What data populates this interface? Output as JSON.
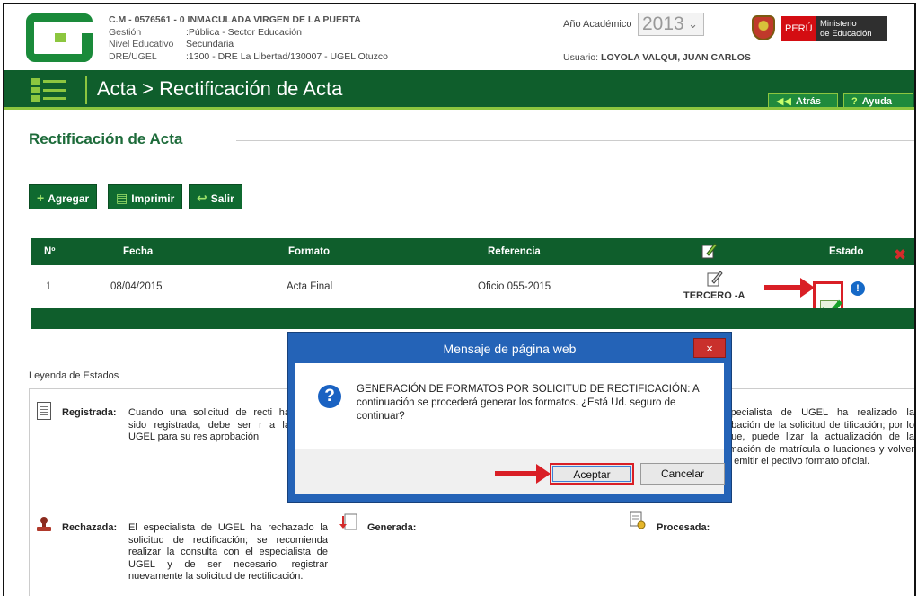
{
  "header": {
    "cm_line": "C.M - 0576561 - 0  INMACULADA VIRGEN DE LA PUERTA",
    "rows": [
      {
        "label": "Gestión",
        "value": ":Pública - Sector Educación"
      },
      {
        "label": "Nivel Educativo",
        "value": "Secundaria"
      },
      {
        "label": "DRE/UGEL",
        "value": ":1300 - DRE La Libertad/130007 - UGEL Otuzco"
      }
    ],
    "anio_label": "Año Académico",
    "anio_value": "2013",
    "usuario_label": "Usuario:",
    "usuario_value": "LOYOLA VALQUI, JUAN CARLOS",
    "peru_label": "PERÚ",
    "ministerio_line1": "Ministerio",
    "ministerio_line2": "de Educación"
  },
  "titlebar": {
    "title": "Acta > Rectificación de Acta",
    "atras_label": "Atrás",
    "ayuda_label": "Ayuda"
  },
  "page": {
    "title": "Rectificación de Acta",
    "actions": {
      "agregar": "Agregar",
      "imprimir": "Imprimir",
      "salir": "Salir"
    }
  },
  "table": {
    "headers": {
      "num": "Nº",
      "fecha": "Fecha",
      "formato": "Formato",
      "referencia": "Referencia",
      "estado": "Estado"
    },
    "rows": [
      {
        "num": "1",
        "fecha": "08/04/2015",
        "formato": "Acta Final",
        "referencia": "Oficio 055-2015",
        "seccion": "TERCERO -A"
      }
    ]
  },
  "leyenda": {
    "title": "Leyenda de Estados",
    "registrada_label": "Registrada:",
    "registrada_text": "Cuando una solicitud de recti ha sido registrada, debe ser r a la UGEL para su res aprobación",
    "procesada_partial_text": "specialista de UGEL ha realizado la obación de la solicitud de tificación; por lo que, puede lizar la actualización de la rmación de matrícula o luaciones y volver a emitir el pectivo formato oficial.",
    "rechazada_label": "Rechazada:",
    "rechazada_text": "El especialista de UGEL ha rechazado la solicitud de rectificación; se recomienda realizar la consulta con el especialista de UGEL y de ser necesario, registrar nuevamente la solicitud de rectificación.",
    "generada_label": "Generada:",
    "procesada_label": "Procesada:"
  },
  "dialog": {
    "caption": "Mensaje de página web",
    "close": "×",
    "message": "GENERACIÓN DE FORMATOS POR SOLICITUD DE RECTIFICACIÓN: A continuación se procederá generar los formatos. ¿Está Ud. seguro de continuar?",
    "accept": "Aceptar",
    "cancel": "Cancelar"
  },
  "colors": {
    "dark_green": "#0f5e2c",
    "light_green": "#8cc63f",
    "title_green": "#1d6b3a",
    "highlight_red": "#d91f26",
    "dialog_blue": "#2463b7"
  },
  "icons": [
    "minedu-logo",
    "menu-list-icon",
    "back-arrow-icon",
    "help-icon",
    "plus-icon",
    "printer-icon",
    "exit-icon",
    "edit-pencil-icon",
    "delete-x-icon",
    "approved-check-icon",
    "info-icon",
    "document-icon",
    "stamp-icon",
    "pdf-icon",
    "process-icon",
    "question-icon",
    "close-icon"
  ]
}
